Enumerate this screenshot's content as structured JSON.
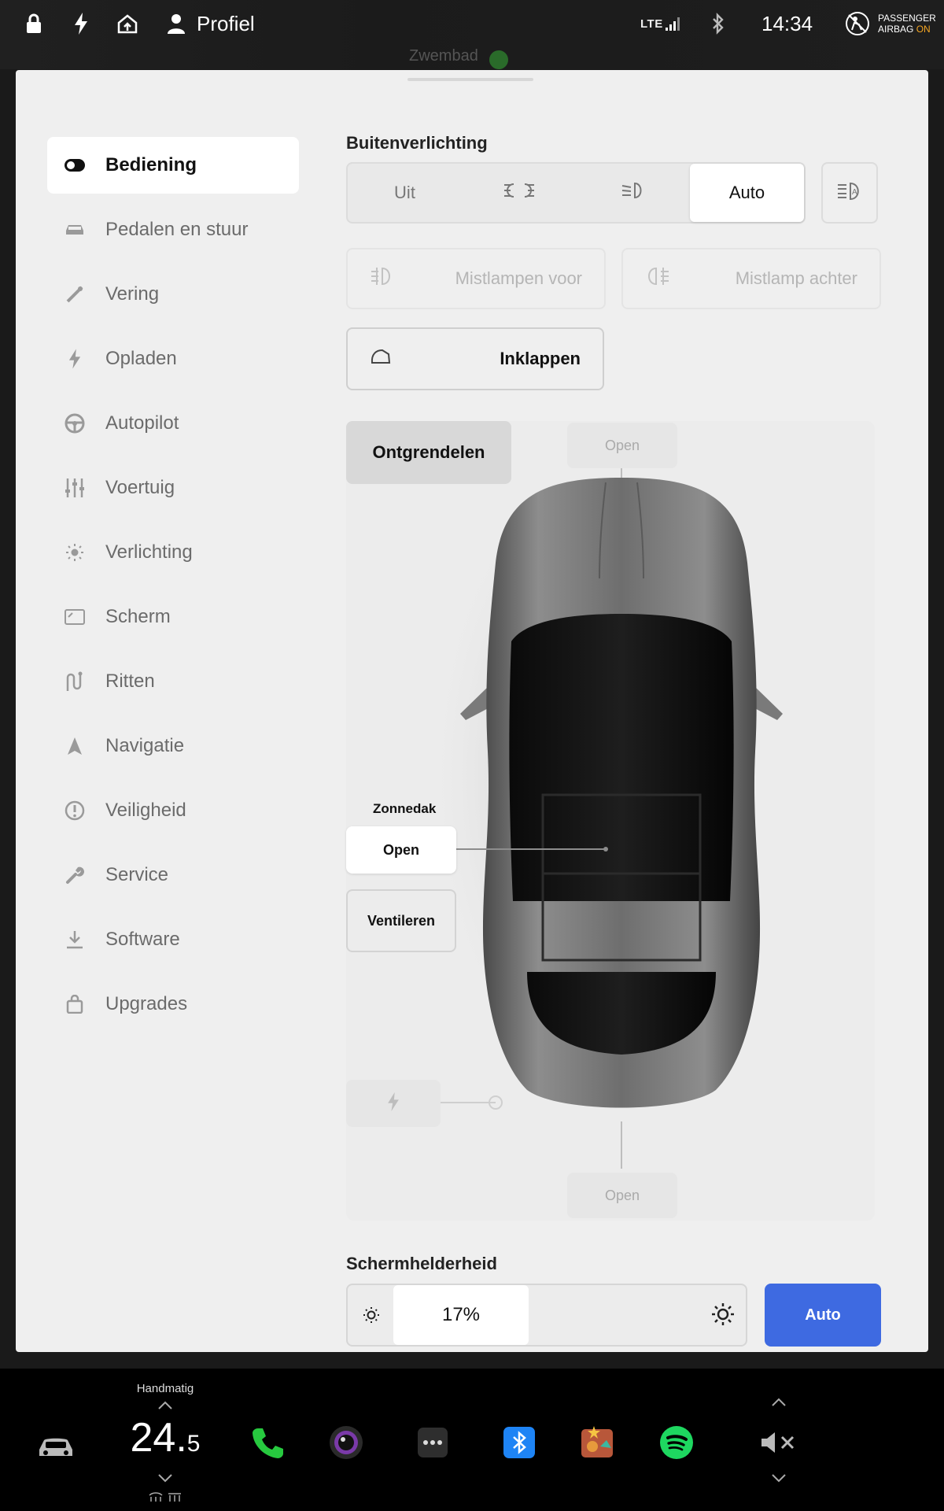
{
  "topbar": {
    "profile_label": "Profiel",
    "network": "LTE",
    "time": "14:34",
    "airbag_line1": "PASSENGER",
    "airbag_line2_prefix": "AIRBAG ",
    "airbag_status": "ON",
    "map_label": "Zwembad",
    "icons": [
      "lock-icon",
      "bolt-icon",
      "home-icon",
      "user-icon",
      "signal-icon",
      "bluetooth-icon",
      "airbag-icon"
    ]
  },
  "sidebar": {
    "items": [
      {
        "label": "Bediening",
        "icon": "toggle-icon",
        "active": true
      },
      {
        "label": "Pedalen en stuur",
        "icon": "car-icon"
      },
      {
        "label": "Vering",
        "icon": "suspension-icon"
      },
      {
        "label": "Opladen",
        "icon": "bolt-icon"
      },
      {
        "label": "Autopilot",
        "icon": "steering-wheel-icon"
      },
      {
        "label": "Voertuig",
        "icon": "sliders-icon"
      },
      {
        "label": "Verlichting",
        "icon": "sun-icon"
      },
      {
        "label": "Scherm",
        "icon": "screen-icon"
      },
      {
        "label": "Ritten",
        "icon": "trips-icon"
      },
      {
        "label": "Navigatie",
        "icon": "navigation-icon"
      },
      {
        "label": "Veiligheid",
        "icon": "safety-icon"
      },
      {
        "label": "Service",
        "icon": "wrench-icon"
      },
      {
        "label": "Software",
        "icon": "download-icon"
      },
      {
        "label": "Upgrades",
        "icon": "bag-icon"
      }
    ]
  },
  "lighting": {
    "title": "Buitenverlichting",
    "options": [
      "Uit",
      "",
      "",
      "Auto"
    ],
    "selected": "Auto",
    "fog_front": "Mistlampen voor",
    "fog_rear": "Mistlamp achter"
  },
  "mirrors": {
    "fold_label": "Inklappen"
  },
  "car": {
    "unlock_label": "Ontgrendelen",
    "frunk_label": "Open",
    "trunk_label": "Open",
    "sunroof_title": "Zonnedak",
    "sunroof_open": "Open",
    "sunroof_vent": "Ventileren"
  },
  "brightness": {
    "title": "Schermhelderheid",
    "value_label": "17%",
    "value": 17,
    "auto_label": "Auto",
    "accent": "#3e6ae1"
  },
  "dock": {
    "mode_label": "Handmatig",
    "temp_whole": "24.",
    "temp_decimal": "5",
    "apps": [
      "car-icon",
      "phone-icon",
      "camera-icon",
      "more-icon",
      "bluetooth-icon",
      "games-icon",
      "spotify-icon",
      "mute-icon"
    ]
  }
}
